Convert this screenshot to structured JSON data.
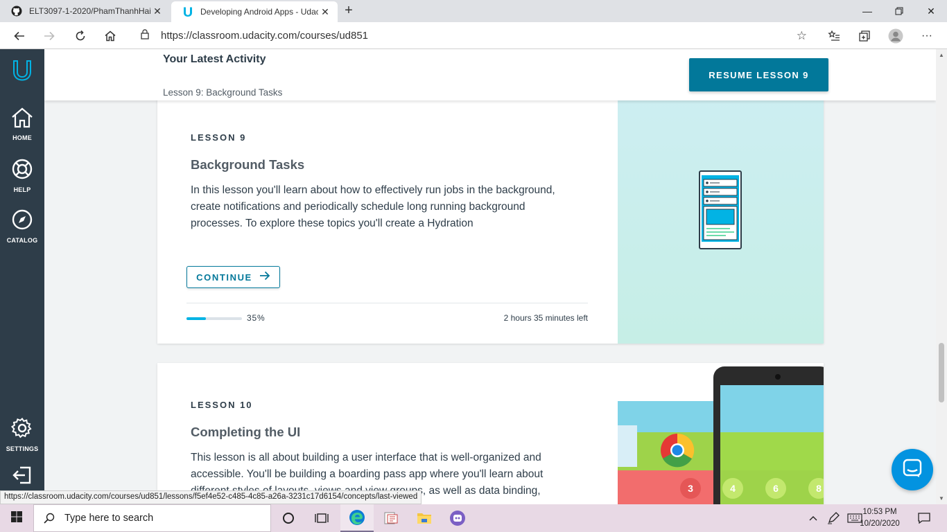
{
  "browser": {
    "tabs": [
      {
        "title": "ELT3097-1-2020/PhamThanhHai",
        "icon": "github-icon"
      },
      {
        "title": "Developing Android Apps - Udac",
        "icon": "udacity-icon"
      }
    ],
    "url": "https://classroom.udacity.com/courses/ud851",
    "status_url": "https://classroom.udacity.com/courses/ud851/lessons/f5ef4e52-c485-4c85-a26a-3231c17d6154/concepts/last-viewed"
  },
  "sidebar": {
    "items": [
      {
        "label": "HOME",
        "icon": "home-icon"
      },
      {
        "label": "HELP",
        "icon": "lifebuoy-icon"
      },
      {
        "label": "CATALOG",
        "icon": "compass-icon"
      },
      {
        "label": "SETTINGS",
        "icon": "gear-icon"
      }
    ]
  },
  "activity": {
    "title": "Your Latest Activity",
    "subtitle": "Lesson 9: Background Tasks",
    "resume_label": "RESUME LESSON 9"
  },
  "lessons": [
    {
      "number": "LESSON 9",
      "title": "Background Tasks",
      "description": "In this lesson you'll learn about how to effectively run jobs in the background, create notifications and periodically schedule long running background processes. To explore these topics you'll create a Hydration",
      "continue_label": "CONTINUE",
      "progress": 0.35,
      "progress_label": "35%",
      "time_left": "2 hours 35 minutes left"
    },
    {
      "number": "LESSON 10",
      "title": "Completing the UI",
      "description": "This lesson is all about building a user interface that is well-organized and accessible. You'll be building a boarding pass app where you'll learn about different styles of layouts, views and view groups, as well as data binding,"
    }
  ],
  "phone_art": {
    "numbers": [
      "3",
      "4",
      "6",
      "8"
    ]
  },
  "taskbar": {
    "search_placeholder": "Type here to search",
    "time": "10:53 PM",
    "date": "10/20/2020"
  },
  "colors": {
    "udacity_dark": "#2e3d49",
    "udacity_blue": "#02789a",
    "progress_green": "#02b3e4"
  }
}
